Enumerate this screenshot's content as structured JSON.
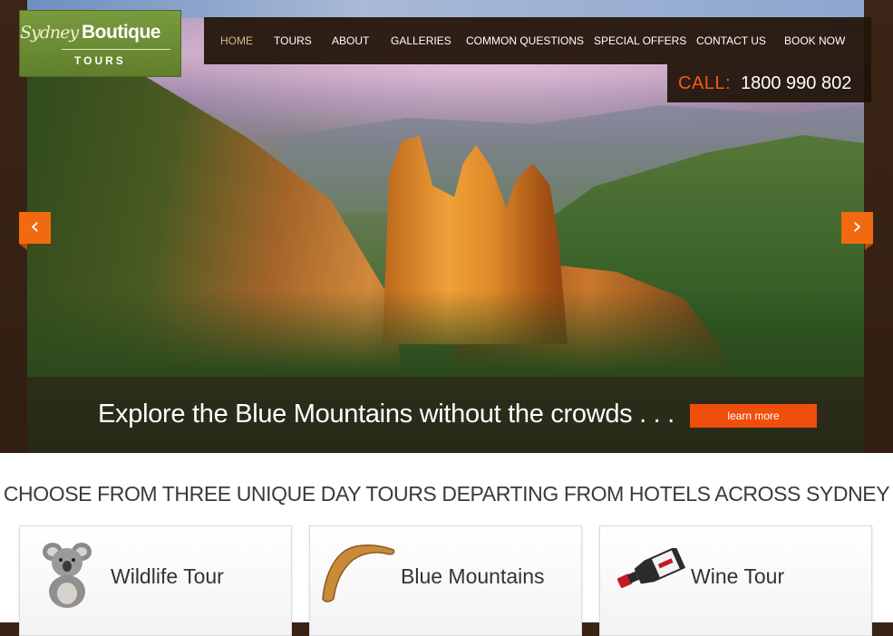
{
  "brand": {
    "script": "Sydney",
    "name": "Boutique",
    "sub": "TOURS",
    "color": "#6b8a33"
  },
  "nav": {
    "items": [
      {
        "label": "HOME",
        "active": true
      },
      {
        "label": "TOURS"
      },
      {
        "label": "ABOUT"
      },
      {
        "label": "GALLERIES"
      },
      {
        "label": "COMMON QUESTIONS"
      },
      {
        "label": "SPECIAL OFFERS"
      },
      {
        "label": "CONTACT US"
      },
      {
        "label": "BOOK NOW"
      }
    ]
  },
  "call": {
    "label": "CALL:",
    "number": "1800 990 802"
  },
  "hero": {
    "caption": "Explore the Blue Mountains without the crowds . . .",
    "button": "learn more",
    "prev_glyph": "‹",
    "next_glyph": "›"
  },
  "section": {
    "headline": "CHOOSE FROM THREE UNIQUE DAY TOURS DEPARTING FROM HOTELS ACROSS SYDNEY"
  },
  "tours": [
    {
      "title": "Wildlife Tour",
      "icon": "koala-icon"
    },
    {
      "title": "Blue Mountains",
      "icon": "boomerang-icon"
    },
    {
      "title": "Wine Tour",
      "icon": "wine-bottle-icon"
    }
  ],
  "colors": {
    "accent": "#f04e0c",
    "nav_bg": "#22140a",
    "frame": "#3a2416"
  }
}
